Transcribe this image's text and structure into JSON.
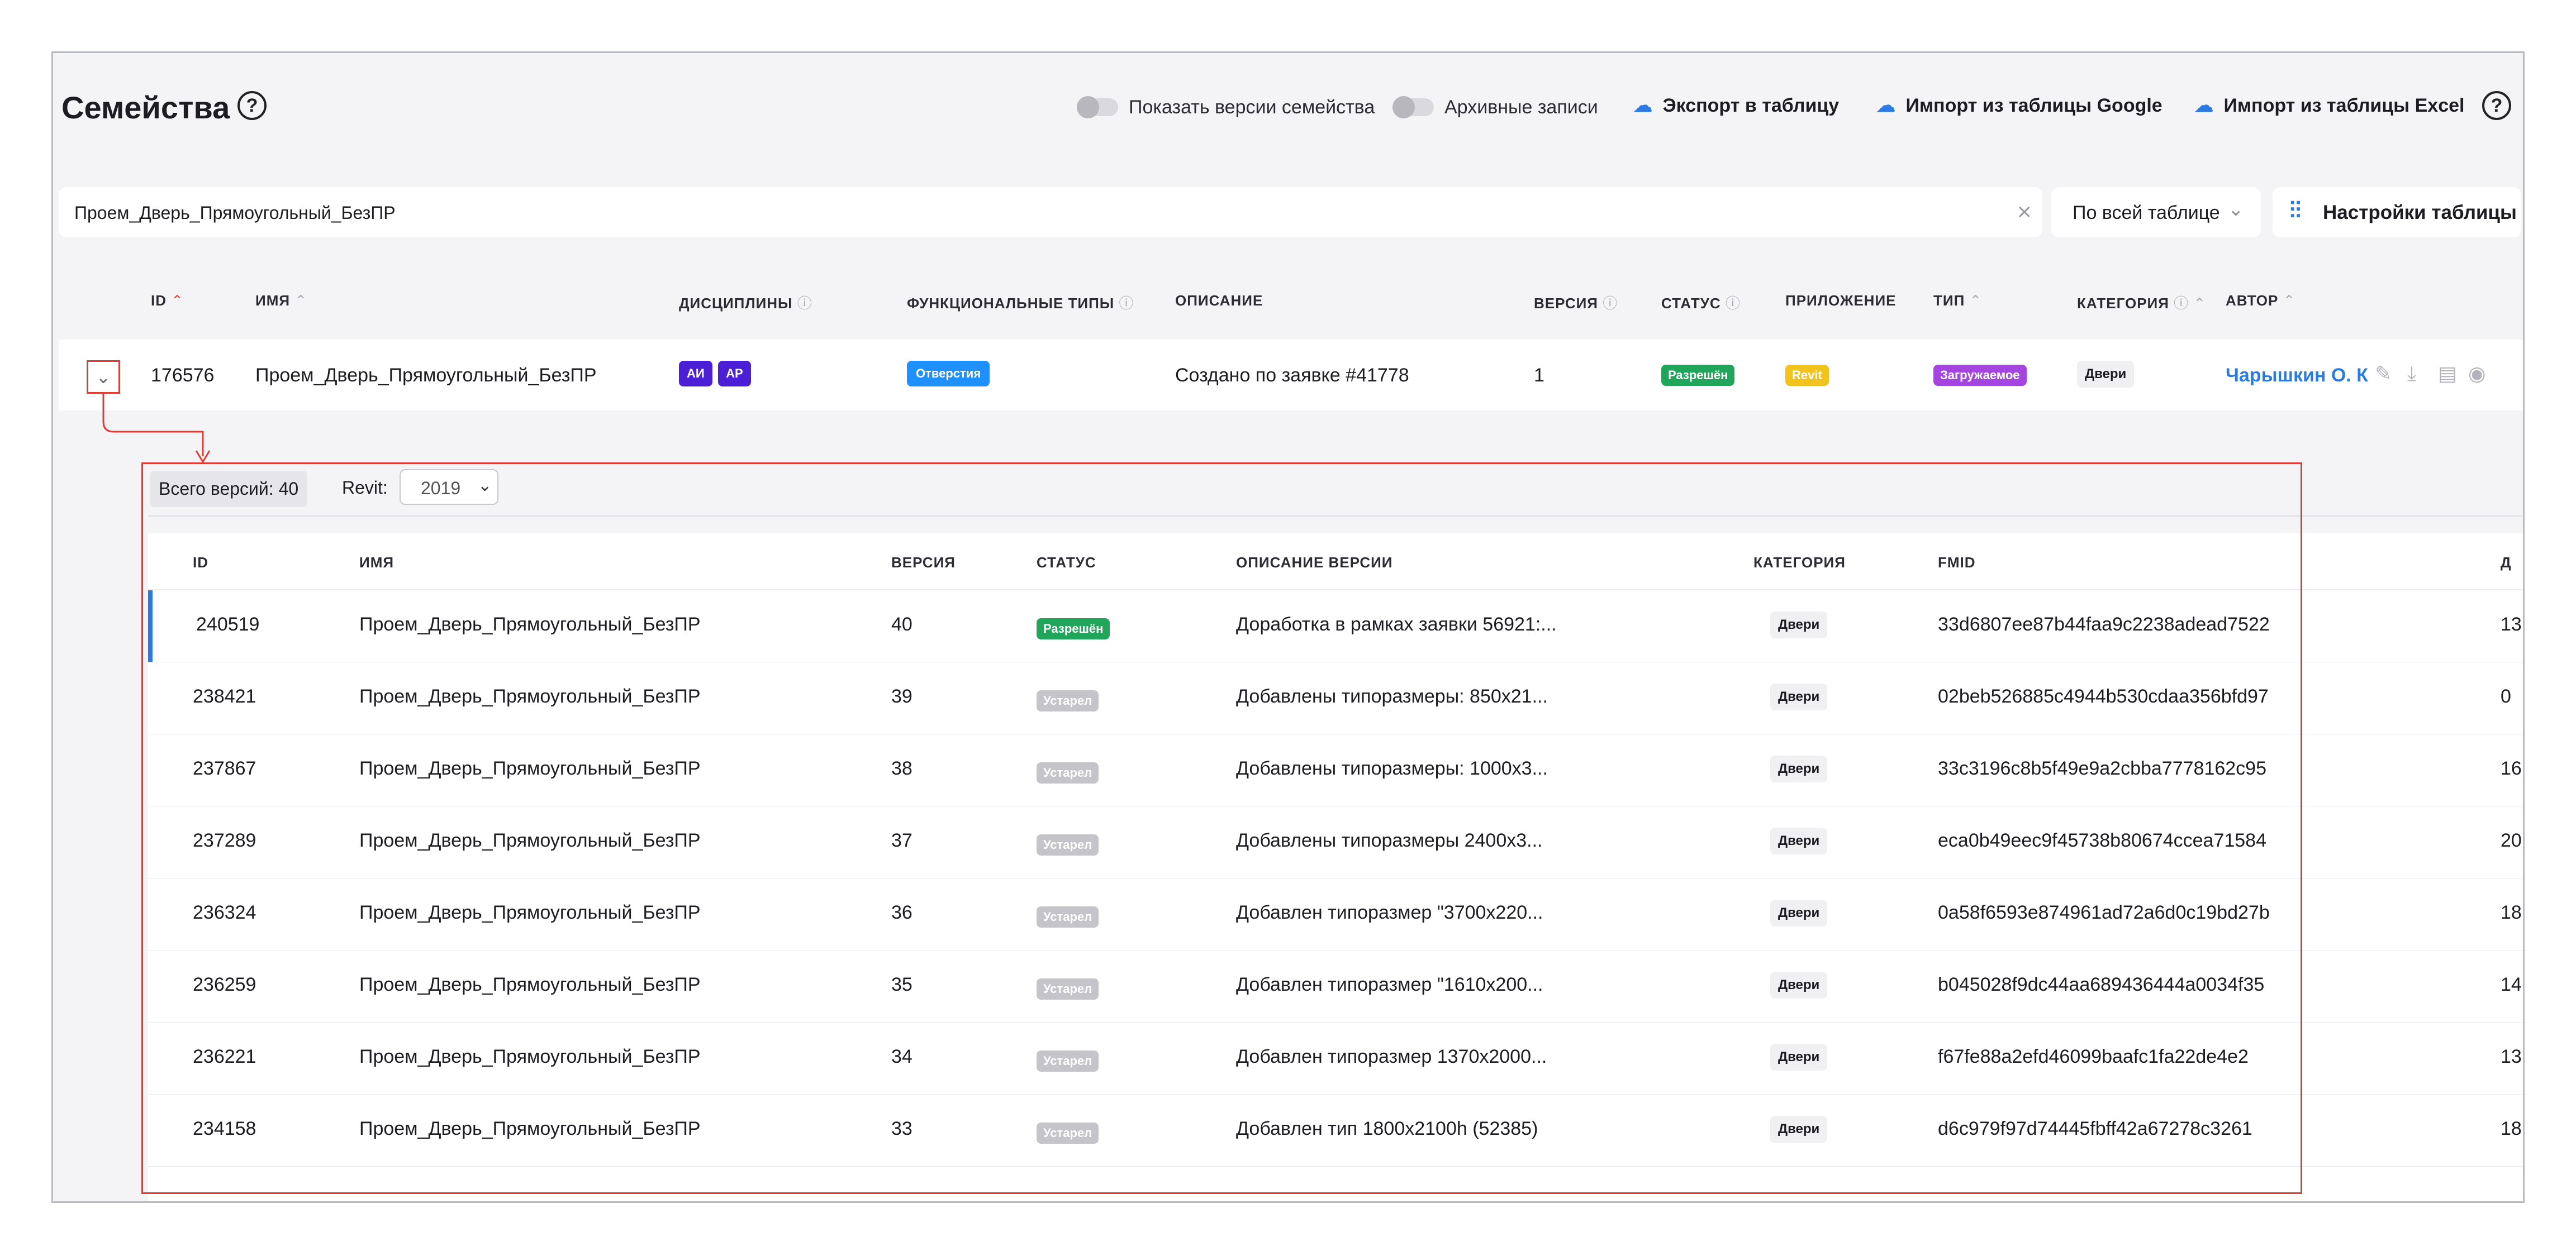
{
  "header": {
    "title": "Семейства",
    "help": "?",
    "toggle_versions": "Показать версии семейства",
    "toggle_archive": "Архивные записи",
    "export": "Экспорт в таблицу",
    "import_google": "Импорт из таблицы Google",
    "import_excel": "Импорт из таблицы Excel"
  },
  "search": {
    "value": "Проем_Дверь_Прямоугольный_БезПР",
    "scope": "По всей таблице",
    "settings": "Настройки таблицы"
  },
  "columns": {
    "id": "ID",
    "name": "ИМЯ",
    "disciplines": "ДИСЦИПЛИНЫ",
    "func_types": "ФУНКЦИОНАЛЬНЫЕ ТИПЫ",
    "description": "ОПИСАНИЕ",
    "version": "ВЕРСИЯ",
    "status": "СТАТУС",
    "app": "ПРИЛОЖЕНИЕ",
    "type": "ТИП",
    "category": "КАТЕГОРИЯ",
    "author": "АВТОР"
  },
  "family": {
    "id": "176576",
    "name": "Проем_Дверь_Прямоугольный_БезПР",
    "disc1": "АИ",
    "disc2": "АР",
    "func_type": "Отверстия",
    "description": "Создано по заявке #41778",
    "version": "1",
    "status": "Разрешён",
    "app": "Revit",
    "type": "Загружаемое",
    "category": "Двери",
    "author": "Чарышкин О. К"
  },
  "versions_panel": {
    "total": "Всего версий: 40",
    "revit_label": "Revit:",
    "revit_value": "2019",
    "columns": {
      "id": "ID",
      "name": "ИМЯ",
      "version": "ВЕРСИЯ",
      "status": "СТАТУС",
      "desc": "ОПИСАНИЕ ВЕРСИИ",
      "category": "КАТЕГОРИЯ",
      "fmid": "FMID",
      "date": "Д"
    },
    "rows": [
      {
        "id": "240519",
        "name": "Проем_Дверь_Прямоугольный_БезПР",
        "version": "40",
        "status": "Разрешён",
        "desc": "Доработка в рамках заявки 56921:...",
        "category": "Двери",
        "fmid": "33d6807ee87b44faa9c2238adead7522",
        "date": "13"
      },
      {
        "id": "238421",
        "name": "Проем_Дверь_Прямоугольный_БезПР",
        "version": "39",
        "status": "Устарел",
        "desc": "Добавлены типоразмеры: 850x21...",
        "category": "Двери",
        "fmid": "02beb526885c4944b530cdaa356bfd97",
        "date": "0"
      },
      {
        "id": "237867",
        "name": "Проем_Дверь_Прямоугольный_БезПР",
        "version": "38",
        "status": "Устарел",
        "desc": "Добавлены типоразмеры: 1000x3...",
        "category": "Двери",
        "fmid": "33c3196c8b5f49e9a2cbba7778162c95",
        "date": "16"
      },
      {
        "id": "237289",
        "name": "Проем_Дверь_Прямоугольный_БезПР",
        "version": "37",
        "status": "Устарел",
        "desc": "Добавлены типоразмеры 2400x3...",
        "category": "Двери",
        "fmid": "eca0b49eec9f45738b80674ccea71584",
        "date": "20"
      },
      {
        "id": "236324",
        "name": "Проем_Дверь_Прямоугольный_БезПР",
        "version": "36",
        "status": "Устарел",
        "desc": "Добавлен типоразмер \"3700x220...",
        "category": "Двери",
        "fmid": "0a58f6593e874961ad72a6d0c19bd27b",
        "date": "18"
      },
      {
        "id": "236259",
        "name": "Проем_Дверь_Прямоугольный_БезПР",
        "version": "35",
        "status": "Устарел",
        "desc": "Добавлен типоразмер \"1610x200...",
        "category": "Двери",
        "fmid": "b045028f9dc44aa689436444a0034f35",
        "date": "14"
      },
      {
        "id": "236221",
        "name": "Проем_Дверь_Прямоугольный_БезПР",
        "version": "34",
        "status": "Устарел",
        "desc": "Добавлен типоразмер 1370x2000...",
        "category": "Двери",
        "fmid": "f67fe88a2efd46099baafc1fa22de4e2",
        "date": "13"
      },
      {
        "id": "234158",
        "name": "Проем_Дверь_Прямоугольный_БезПР",
        "version": "33",
        "status": "Устарел",
        "desc": "Добавлен тип 1800x2100h (52385)",
        "category": "Двери",
        "fmid": "d6c979f97d74445fbff42a67278c3261",
        "date": "18"
      }
    ]
  },
  "colors": {
    "accent": "#2c7be5",
    "highlight_red": "#e23b33",
    "status_allowed": "#1fa65a",
    "status_outdated": "#c4c4ca"
  }
}
